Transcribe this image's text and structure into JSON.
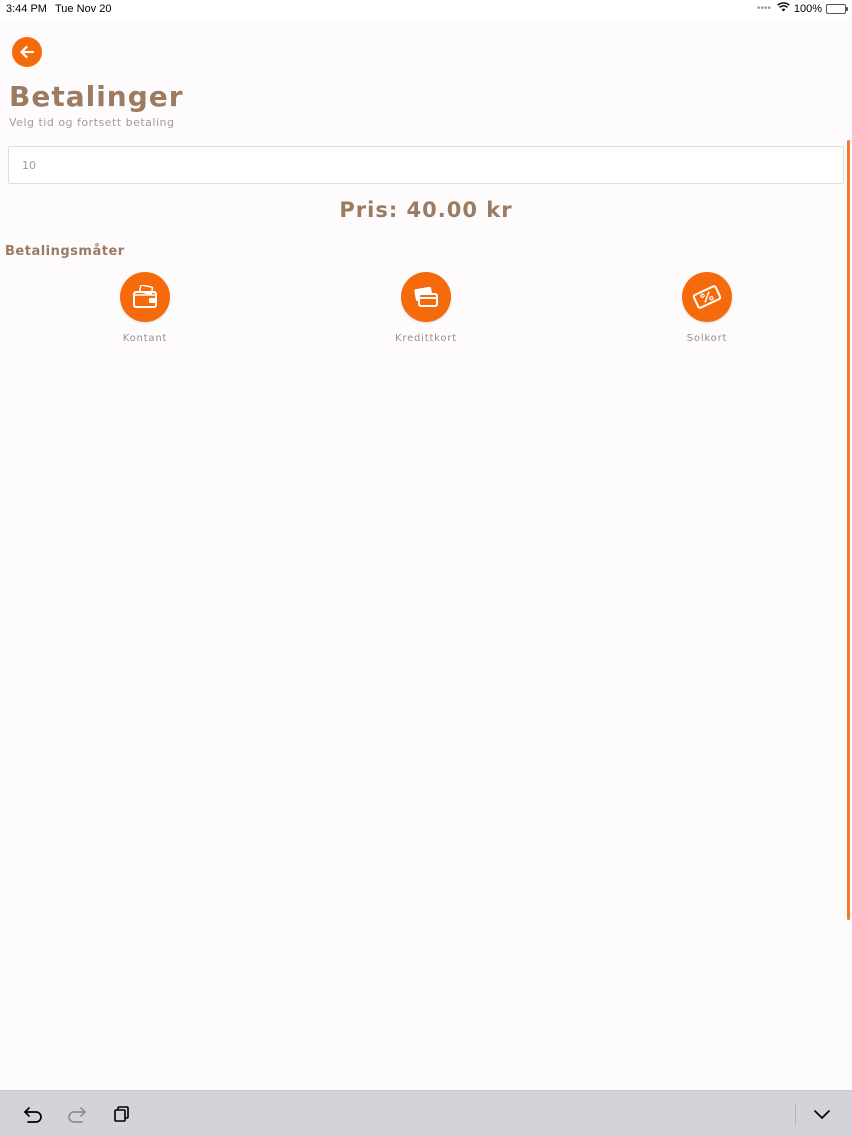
{
  "status_bar": {
    "time": "3:44 PM",
    "date": "Tue Nov 20",
    "signal_dots": "••••",
    "battery": "100%"
  },
  "header": {
    "title": "Betalinger",
    "subtitle": "Velg tid og fortsett betaling"
  },
  "time_input": {
    "value": "10",
    "placeholder": ""
  },
  "price": {
    "text": "Pris: 40.00 kr"
  },
  "payment_methods": {
    "title": "Betalingsmåter",
    "items": [
      {
        "label": "Kontant",
        "icon": "wallet-icon"
      },
      {
        "label": "Kredittkort",
        "icon": "credit-card-icon"
      },
      {
        "label": "Solkort",
        "icon": "discount-card-icon"
      }
    ]
  },
  "colors": {
    "accent": "#f56a0a",
    "title": "#9b7b62",
    "background": "#fdfbfb",
    "toolbar": "#d2d4d9"
  }
}
